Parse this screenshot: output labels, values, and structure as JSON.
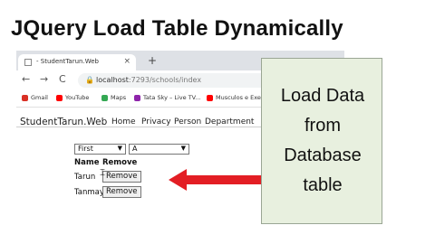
{
  "headline": "JQuery Load Table Dynamically",
  "browser": {
    "tab_title": "- StudentTarun.Web",
    "tab_close": "×",
    "new_tab": "+",
    "back": "←",
    "forward": "→",
    "reload": "C",
    "url_host": "localhost",
    "url_path": ":7293/schools/index",
    "bookmarks": [
      "Gmail",
      "YouTube",
      "Maps",
      "Tata Sky – Live TV...",
      "Musculos e Exerci"
    ],
    "bookmark_colors": [
      "#d93025",
      "#ff0000",
      "#34a853",
      "#8e24aa",
      "#ff0000"
    ]
  },
  "app": {
    "brand": "StudentTarun.Web",
    "nav": [
      "Home",
      "Privacy",
      "Person",
      "Department"
    ]
  },
  "filters": {
    "first_select": "First",
    "second_select": "A"
  },
  "table": {
    "headers": [
      "Name",
      "Remove"
    ],
    "rows": [
      {
        "name": "Tarun",
        "action": "Remove"
      },
      {
        "name": "Tanmay",
        "action": "Remove"
      }
    ]
  },
  "callout": {
    "lines": [
      "Load Data",
      "from",
      "Database",
      "table"
    ]
  },
  "colors": {
    "arrow": "#e31e24",
    "callout_bg": "#e8f0df"
  }
}
